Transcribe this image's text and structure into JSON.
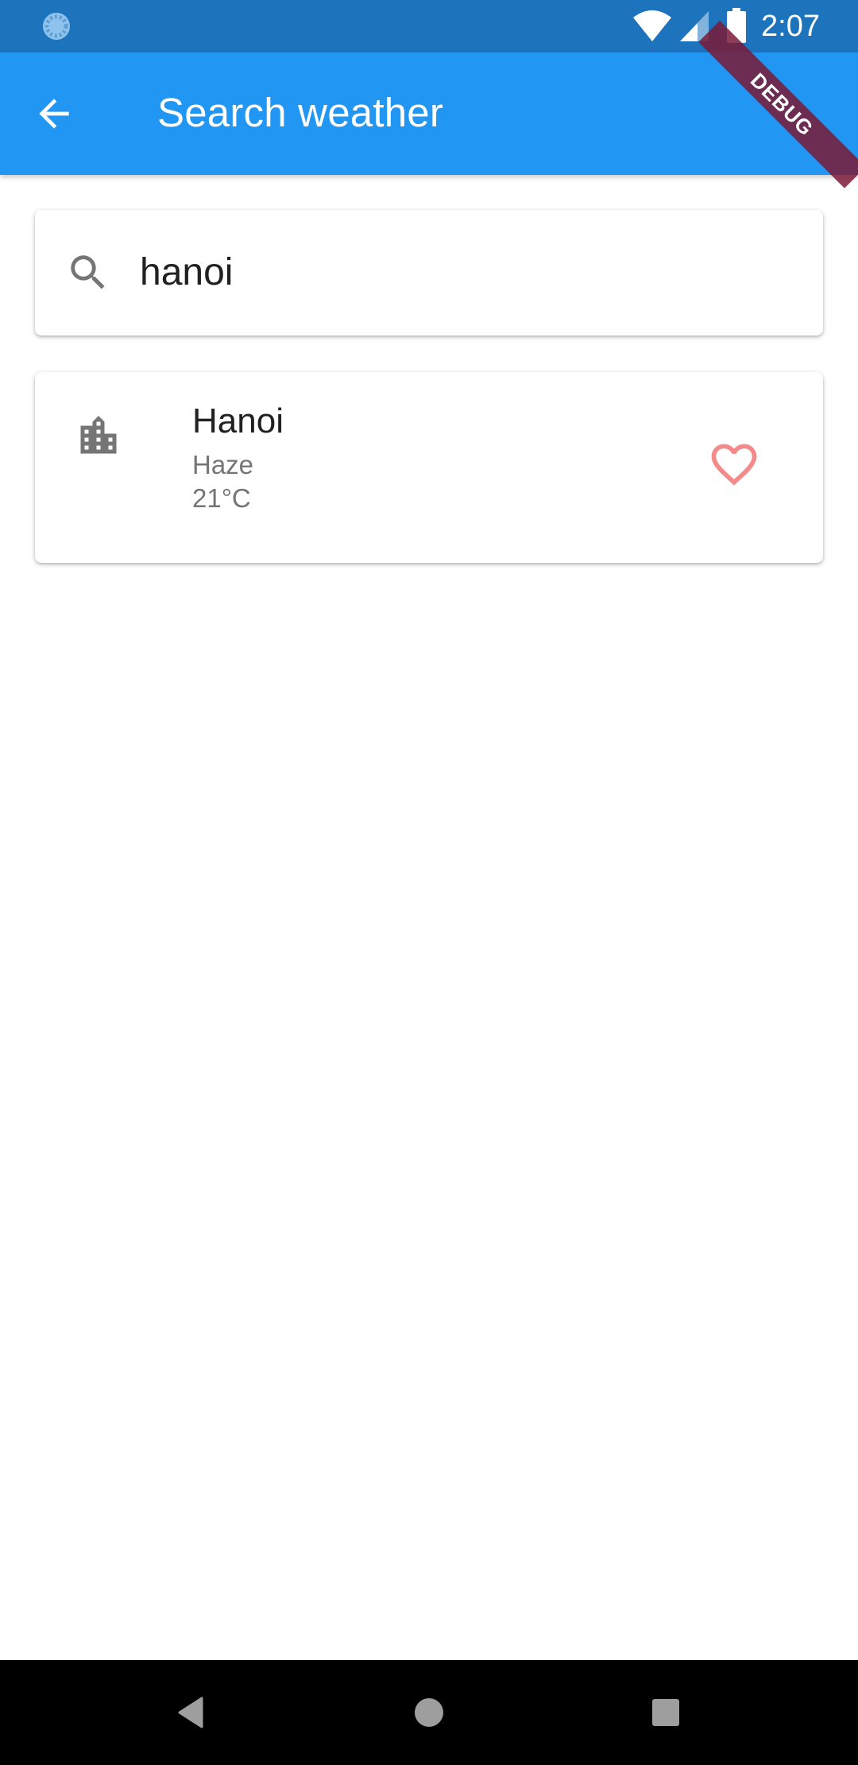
{
  "status_bar": {
    "time": "2:07",
    "icons": [
      "loading-icon",
      "wifi-icon",
      "cell-signal-icon",
      "battery-icon"
    ]
  },
  "app_bar": {
    "title": "Search weather",
    "back_icon": "arrow-back-icon",
    "debug_banner": "DEBUG"
  },
  "search": {
    "value": "hanoi",
    "icon": "search-icon"
  },
  "results": [
    {
      "city": "Hanoi",
      "condition": "Haze",
      "temperature": "21°C",
      "icon": "city-buildings-icon",
      "favorite_icon": "heart-outline-icon"
    }
  ],
  "nav_bar": {
    "buttons": [
      "back-triangle-icon",
      "home-circle-icon",
      "recents-square-icon"
    ]
  },
  "colors": {
    "status_bar": "#1E73BD",
    "app_bar": "#2196F3",
    "favorite": "#F48A8A",
    "icon_grey": "#757575",
    "debug_banner": "#7A1B36"
  }
}
